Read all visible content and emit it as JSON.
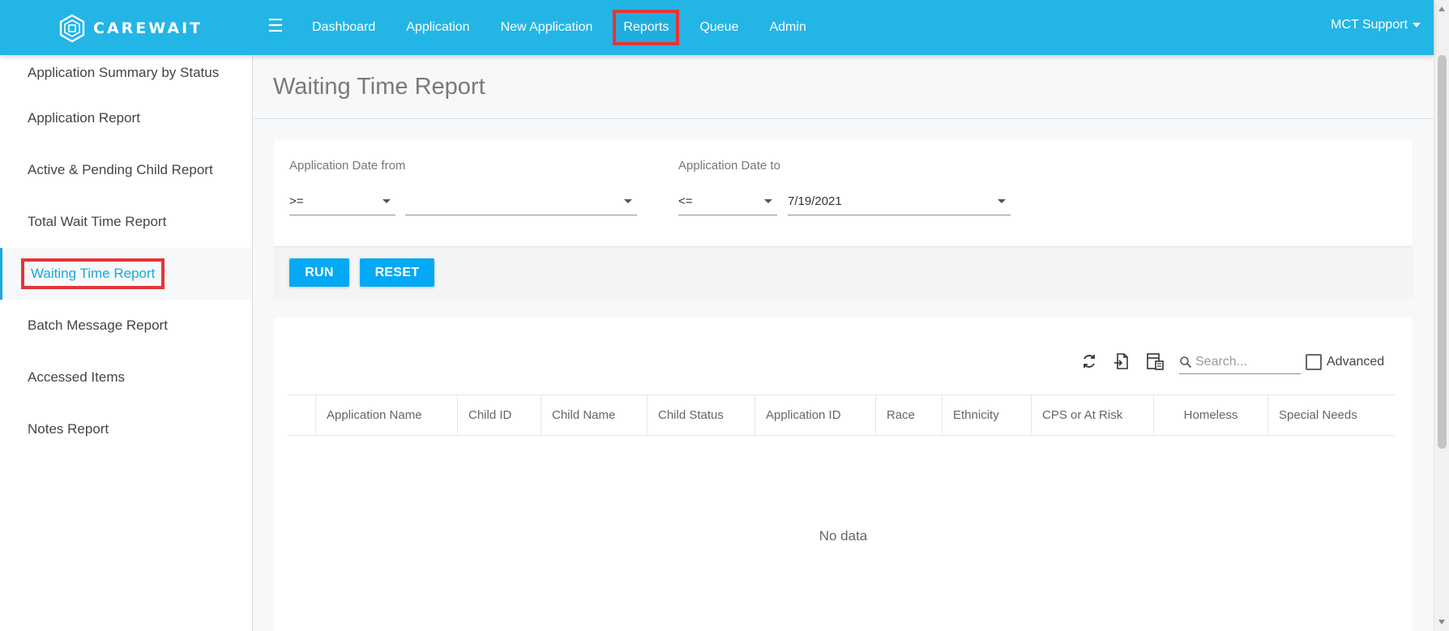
{
  "app": {
    "name": "CAREWAIT",
    "user": "MCT Support"
  },
  "nav": {
    "items": [
      {
        "label": "Dashboard"
      },
      {
        "label": "Application"
      },
      {
        "label": "New Application"
      },
      {
        "label": "Reports"
      },
      {
        "label": "Queue"
      },
      {
        "label": "Admin"
      }
    ],
    "active": "Reports"
  },
  "sidebar": {
    "items": [
      {
        "label": "Application Summary by Status"
      },
      {
        "label": "Application Report"
      },
      {
        "label": "Active & Pending Child Report"
      },
      {
        "label": "Total Wait Time Report"
      },
      {
        "label": "Waiting Time Report"
      },
      {
        "label": "Batch Message Report"
      },
      {
        "label": "Accessed Items"
      },
      {
        "label": "Notes Report"
      }
    ],
    "active": "Waiting Time Report"
  },
  "page": {
    "title": "Waiting Time Report"
  },
  "filters": {
    "date_from": {
      "label": "Application Date from",
      "operator": ">=",
      "value": ""
    },
    "date_to": {
      "label": "Application Date to",
      "operator": "<=",
      "value": "7/19/2021"
    },
    "run_label": "RUN",
    "reset_label": "RESET"
  },
  "grid": {
    "search_placeholder": "Search...",
    "advanced_label": "Advanced",
    "icons": [
      "refresh-icon",
      "export-icon",
      "column-chooser-icon",
      "search-icon"
    ],
    "columns": [
      {
        "label": ""
      },
      {
        "label": "Application Name"
      },
      {
        "label": "Child ID"
      },
      {
        "label": "Child Name"
      },
      {
        "label": "Child Status"
      },
      {
        "label": "Application ID"
      },
      {
        "label": "Race"
      },
      {
        "label": "Ethnicity"
      },
      {
        "label": "CPS or At Risk"
      },
      {
        "label": "Homeless"
      },
      {
        "label": "Special Needs"
      }
    ],
    "empty_text": "No data"
  },
  "colors": {
    "topbar": "#22b5e6",
    "primary_button": "#03a9f4",
    "active_link": "#1aa8dc",
    "highlight_box": "#e8333a"
  }
}
